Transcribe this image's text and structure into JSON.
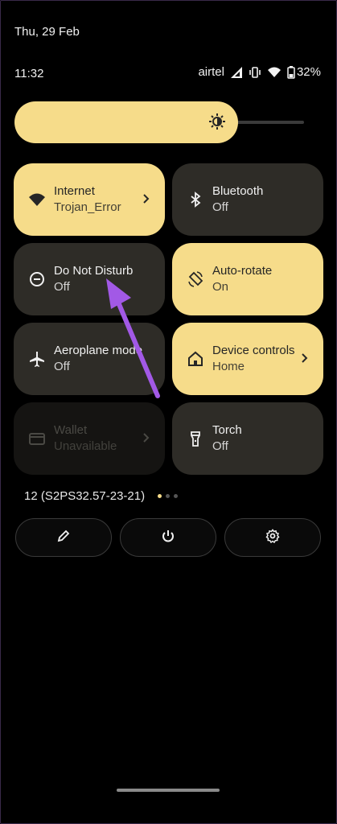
{
  "status": {
    "date": "Thu, 29 Feb",
    "time": "11:32",
    "carrier": "airtel",
    "battery": "32%",
    "icons": [
      "signal-icon",
      "vibrate-icon",
      "wifi-icon",
      "battery-icon"
    ]
  },
  "brightness": {
    "level": 0.72,
    "icon": "brightness-icon"
  },
  "tiles": [
    {
      "title": "Internet",
      "subtitle": "Trojan_Error",
      "state": "on",
      "icon": "wifi-icon",
      "chevron": true
    },
    {
      "title": "Bluetooth",
      "subtitle": "Off",
      "state": "off",
      "icon": "bluetooth-icon",
      "chevron": false
    },
    {
      "title": "Do Not Disturb",
      "subtitle": "Off",
      "state": "off",
      "icon": "do-not-disturb-icon",
      "chevron": false
    },
    {
      "title": "Auto-rotate",
      "subtitle": "On",
      "state": "on",
      "icon": "rotate-icon",
      "chevron": false
    },
    {
      "title": "Aeroplane mode",
      "subtitle": "Off",
      "state": "off",
      "icon": "airplane-icon",
      "chevron": false
    },
    {
      "title": "Device controls",
      "subtitle": "Home",
      "state": "on",
      "icon": "home-icon",
      "chevron": true
    },
    {
      "title": "Wallet",
      "subtitle": "Unavailable",
      "state": "unavailable",
      "icon": "wallet-icon",
      "chevron": true
    },
    {
      "title": "Torch",
      "subtitle": "Off",
      "state": "off",
      "icon": "torch-icon",
      "chevron": false
    }
  ],
  "footer": {
    "build": "12 (S2PS32.57-23-21)",
    "pages": 3,
    "active_page": 1,
    "buttons": [
      "edit-icon",
      "power-icon",
      "settings-icon"
    ]
  },
  "colors": {
    "accent": "#f6dc8a",
    "tile_off": "#2e2c27",
    "annotation_arrow": "#a259e6"
  }
}
